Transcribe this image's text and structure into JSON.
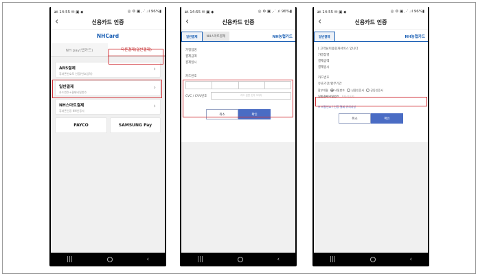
{
  "status": {
    "left": "㏂ 14:55 ✉ ▣ ◆",
    "right": "◎ ⚙ ▣ ⋰ .ıl 96%▮"
  },
  "app_title": "신용카드 인증",
  "phone1": {
    "logo": "NHCard",
    "tabs": [
      "NH pay(앱카드)",
      "다른결제(일반결제)"
    ],
    "items": [
      {
        "title": "ARS결제",
        "subtitle": "휴대폰번호로 인증(번호입력)"
      },
      {
        "title": "일반결제",
        "subtitle": "카드번호+결제비밀번호"
      },
      {
        "title": "NH스마트결제",
        "subtitle": "휴대폰인증 NH인증서"
      }
    ],
    "pay_buttons": [
      "PAYCO",
      "SAMSUNG Pay"
    ]
  },
  "phone2": {
    "tabs": [
      "일반결제",
      "NH스마트결제"
    ],
    "logo": "NH농협카드",
    "info_rows": [
      "가맹점명",
      "결제금액",
      "결제일시"
    ],
    "card_number_label": "카드번호",
    "cvc_label": "CVC / CVV번호",
    "cvc_placeholder": "카드 뒷면 숫자 3자리",
    "cancel": "취소",
    "confirm": "확인"
  },
  "phone3": {
    "tab": "일반결제",
    "logo": "NH농협카드",
    "notice": "[ 고객님이용중개서비스 입니다",
    "info_rows": [
      "가맹점명",
      "결제금액",
      "결제일시"
    ],
    "card_number_label": "카드번호",
    "expiry_label": "유효기간/할부기간",
    "installment_label": "할부개월",
    "radio_options": [
      "비밀번호",
      "신용인증서",
      "공동인증서"
    ],
    "pin_label": "일반결제비밀번호",
    "pin_placeholder": "6자리숫자",
    "note": "※ 비밀번호 / 인증 결제 유의사항",
    "cancel": "취소",
    "confirm": "확인"
  }
}
